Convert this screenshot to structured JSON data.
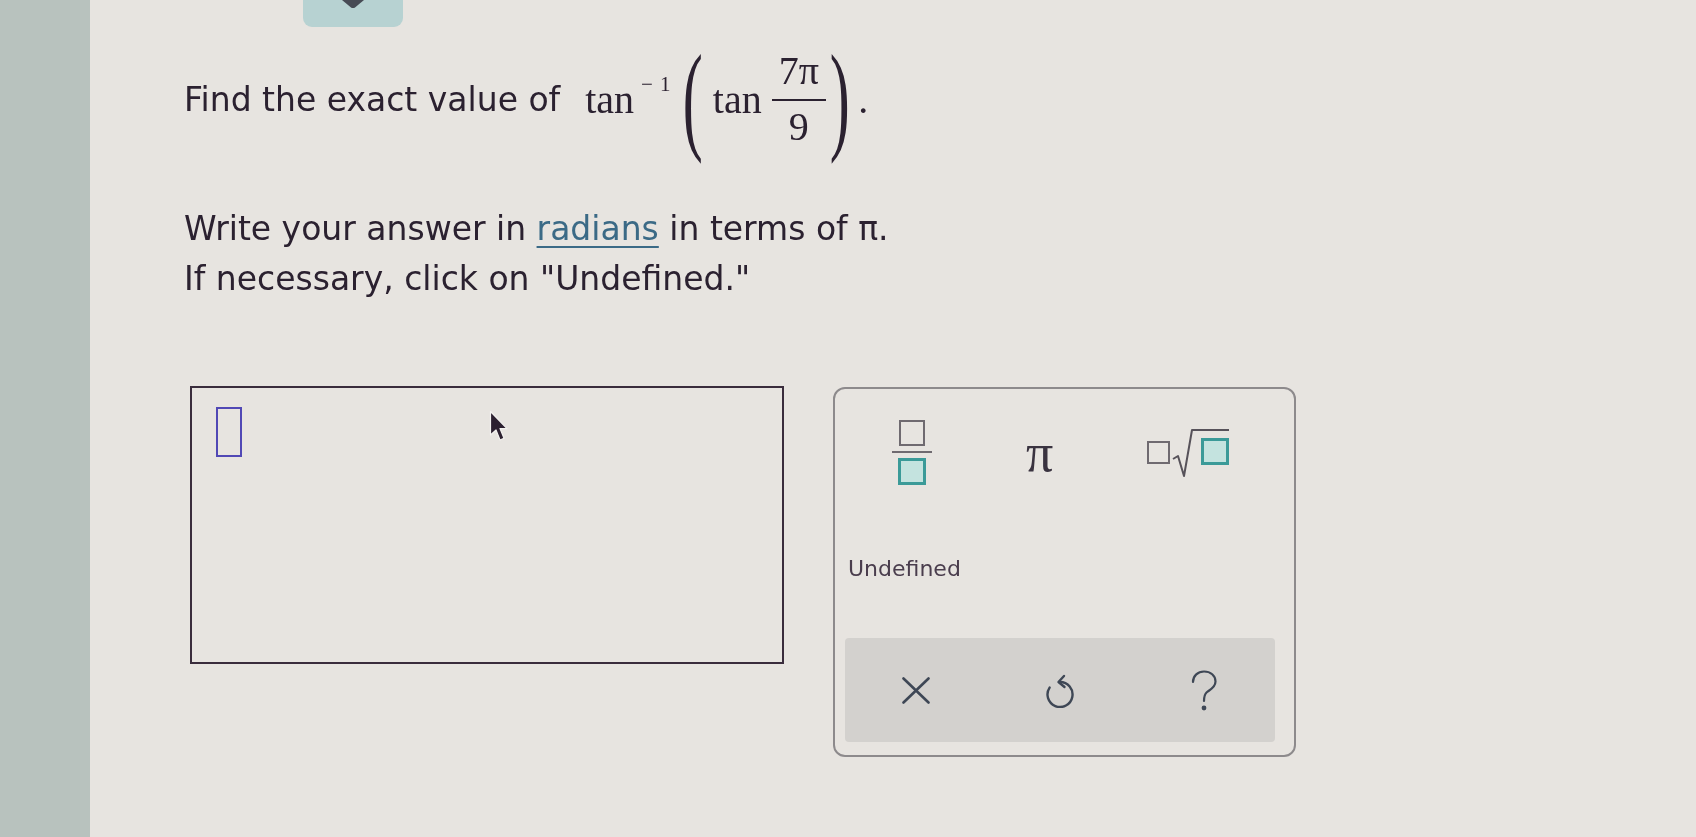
{
  "question": {
    "prompt": "Find the exact value of",
    "expression": {
      "outer": "tan",
      "exponent": "−1",
      "open": "(",
      "inner": "tan",
      "numerator": "7π",
      "denominator": "9",
      "close": ")",
      "end": "."
    }
  },
  "instructions": [
    {
      "parts": [
        {
          "text": "Write your answer in ",
          "link": false
        },
        {
          "text": "radians",
          "link": true
        },
        {
          "text": " in terms of π.",
          "link": false
        }
      ]
    },
    {
      "parts": [
        {
          "text": "If necessary, click on \"Undefined.\"",
          "link": false
        }
      ]
    }
  ],
  "keypad": {
    "keys": [
      {
        "kind": "fraction"
      },
      {
        "kind": "symbol",
        "label": "π"
      },
      {
        "kind": "root"
      }
    ],
    "undefined_button": "Undefined",
    "actions": [
      {
        "kind": "clear"
      },
      {
        "kind": "undo"
      },
      {
        "kind": "help"
      }
    ]
  }
}
